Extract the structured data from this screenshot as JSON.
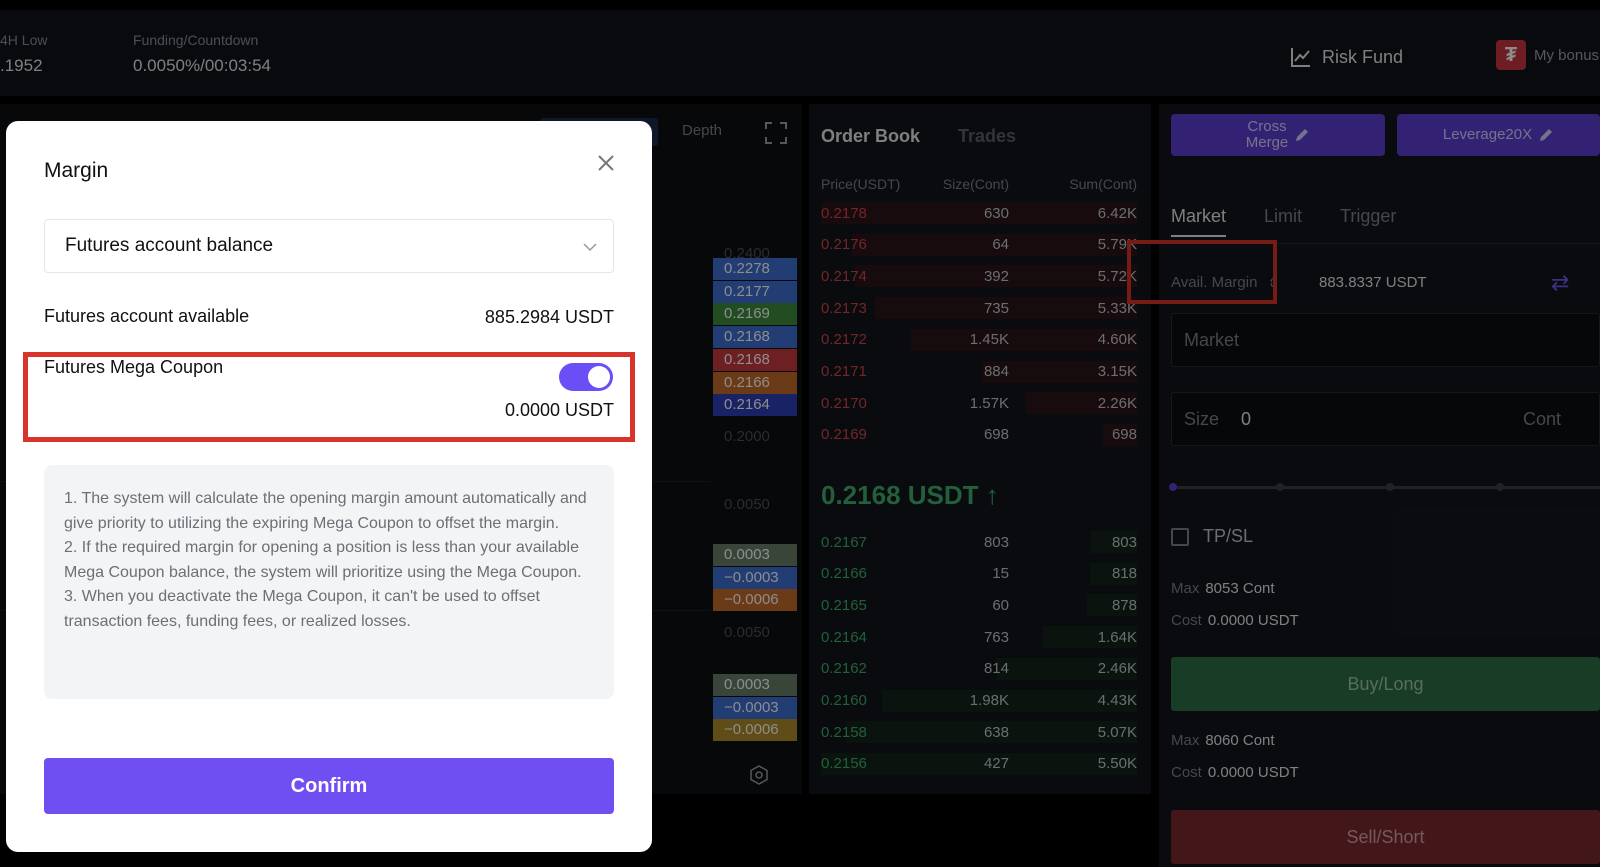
{
  "ticker": {
    "low_label": "4H Low",
    "low_value": ".1952",
    "funding_label": "Funding/Countdown",
    "funding_value": "0.0050%/00:03:54",
    "risk_fund": "Risk Fund",
    "bonus": "My bonus"
  },
  "chart": {
    "tab_depth": "Depth",
    "price_labels": [
      {
        "text": "0.2278",
        "color": "#3d6fd1"
      },
      {
        "text": "0.2177",
        "color": "#3d6fd1"
      },
      {
        "text": "0.2169",
        "color": "#3f8a3c"
      },
      {
        "text": "0.2168",
        "color": "#3d6fd1"
      },
      {
        "text": "0.2168",
        "color": "#c8393e"
      },
      {
        "text": "0.2166",
        "color": "#c46b2a"
      },
      {
        "text": "0.2164",
        "color": "#2e3fb8"
      }
    ],
    "axis_top": "0.2400",
    "axis_low": "0.2000",
    "axis_mid1": "0.0050",
    "axis_mid2": "0.0050",
    "ind1": [
      {
        "text": "0.0003",
        "color": "#6a7f6a"
      },
      {
        "text": "−0.0003",
        "color": "#3d6fd1"
      },
      {
        "text": "−0.0006",
        "color": "#c46b2a"
      }
    ],
    "ind2": [
      {
        "text": "0.0003",
        "color": "#6a7f6a"
      },
      {
        "text": "−0.0003",
        "color": "#3d6fd1"
      },
      {
        "text": "−0.0006",
        "color": "#b08a2a"
      }
    ]
  },
  "orderbook": {
    "tab_book": "Order Book",
    "tab_trades": "Trades",
    "col_price": "Price(USDT)",
    "col_size": "Size(Cont)",
    "col_sum": "Sum(Cont)",
    "asks": [
      [
        "0.2178",
        "630",
        "6.42K"
      ],
      [
        "0.2176",
        "64",
        "5.79K"
      ],
      [
        "0.2174",
        "392",
        "5.72K"
      ],
      [
        "0.2173",
        "735",
        "5.33K"
      ],
      [
        "0.2172",
        "1.45K",
        "4.60K"
      ],
      [
        "0.2171",
        "884",
        "3.15K"
      ],
      [
        "0.2170",
        "1.57K",
        "2.26K"
      ],
      [
        "0.2169",
        "698",
        "698"
      ]
    ],
    "mid": "0.2168 USDT ↑",
    "bids": [
      [
        "0.2167",
        "803",
        "803"
      ],
      [
        "0.2166",
        "15",
        "818"
      ],
      [
        "0.2165",
        "60",
        "878"
      ],
      [
        "0.2164",
        "763",
        "1.64K"
      ],
      [
        "0.2162",
        "814",
        "2.46K"
      ],
      [
        "0.2160",
        "1.98K",
        "4.43K"
      ],
      [
        "0.2158",
        "638",
        "5.07K"
      ],
      [
        "0.2156",
        "427",
        "5.50K"
      ]
    ]
  },
  "trade": {
    "cross_line1": "Cross",
    "cross_line2": "Merge",
    "leverage": "Leverage20X",
    "tab_market": "Market",
    "tab_limit": "Limit",
    "tab_trigger": "Trigger",
    "avail_label": "Avail. Margin",
    "avail_value": "883.8337 USDT",
    "market_placeholder": "Market",
    "size_label": "Size",
    "size_value": "0",
    "size_unit": "Cont",
    "tpsl": "TP/SL",
    "max_label": "Max",
    "buy_max": "8053 Cont",
    "cost_label": "Cost",
    "buy_cost": "0.0000 USDT",
    "buy_label": "Buy/Long",
    "sell_max": "8060 Cont",
    "sell_cost": "0.0000 USDT",
    "sell_label": "Sell/Short"
  },
  "modal": {
    "title": "Margin",
    "select_value": "Futures account balance",
    "available_label": "Futures account available",
    "available_value": "885.2984 USDT",
    "coupon_label": "Futures Mega Coupon",
    "coupon_value": "0.0000 USDT",
    "coupon_enabled": true,
    "note1": "1. The system will calculate the opening margin amount automatically and give priority to utilizing the expiring Mega Coupon to offset the margin.",
    "note2": "2. If the required margin for opening a position is less than your available Mega Coupon balance, the system will prioritize using the Mega Coupon.",
    "note3": "3. When you deactivate the Mega Coupon, it can't be used to offset transaction fees, funding fees, or realized losses.",
    "confirm": "Confirm"
  }
}
